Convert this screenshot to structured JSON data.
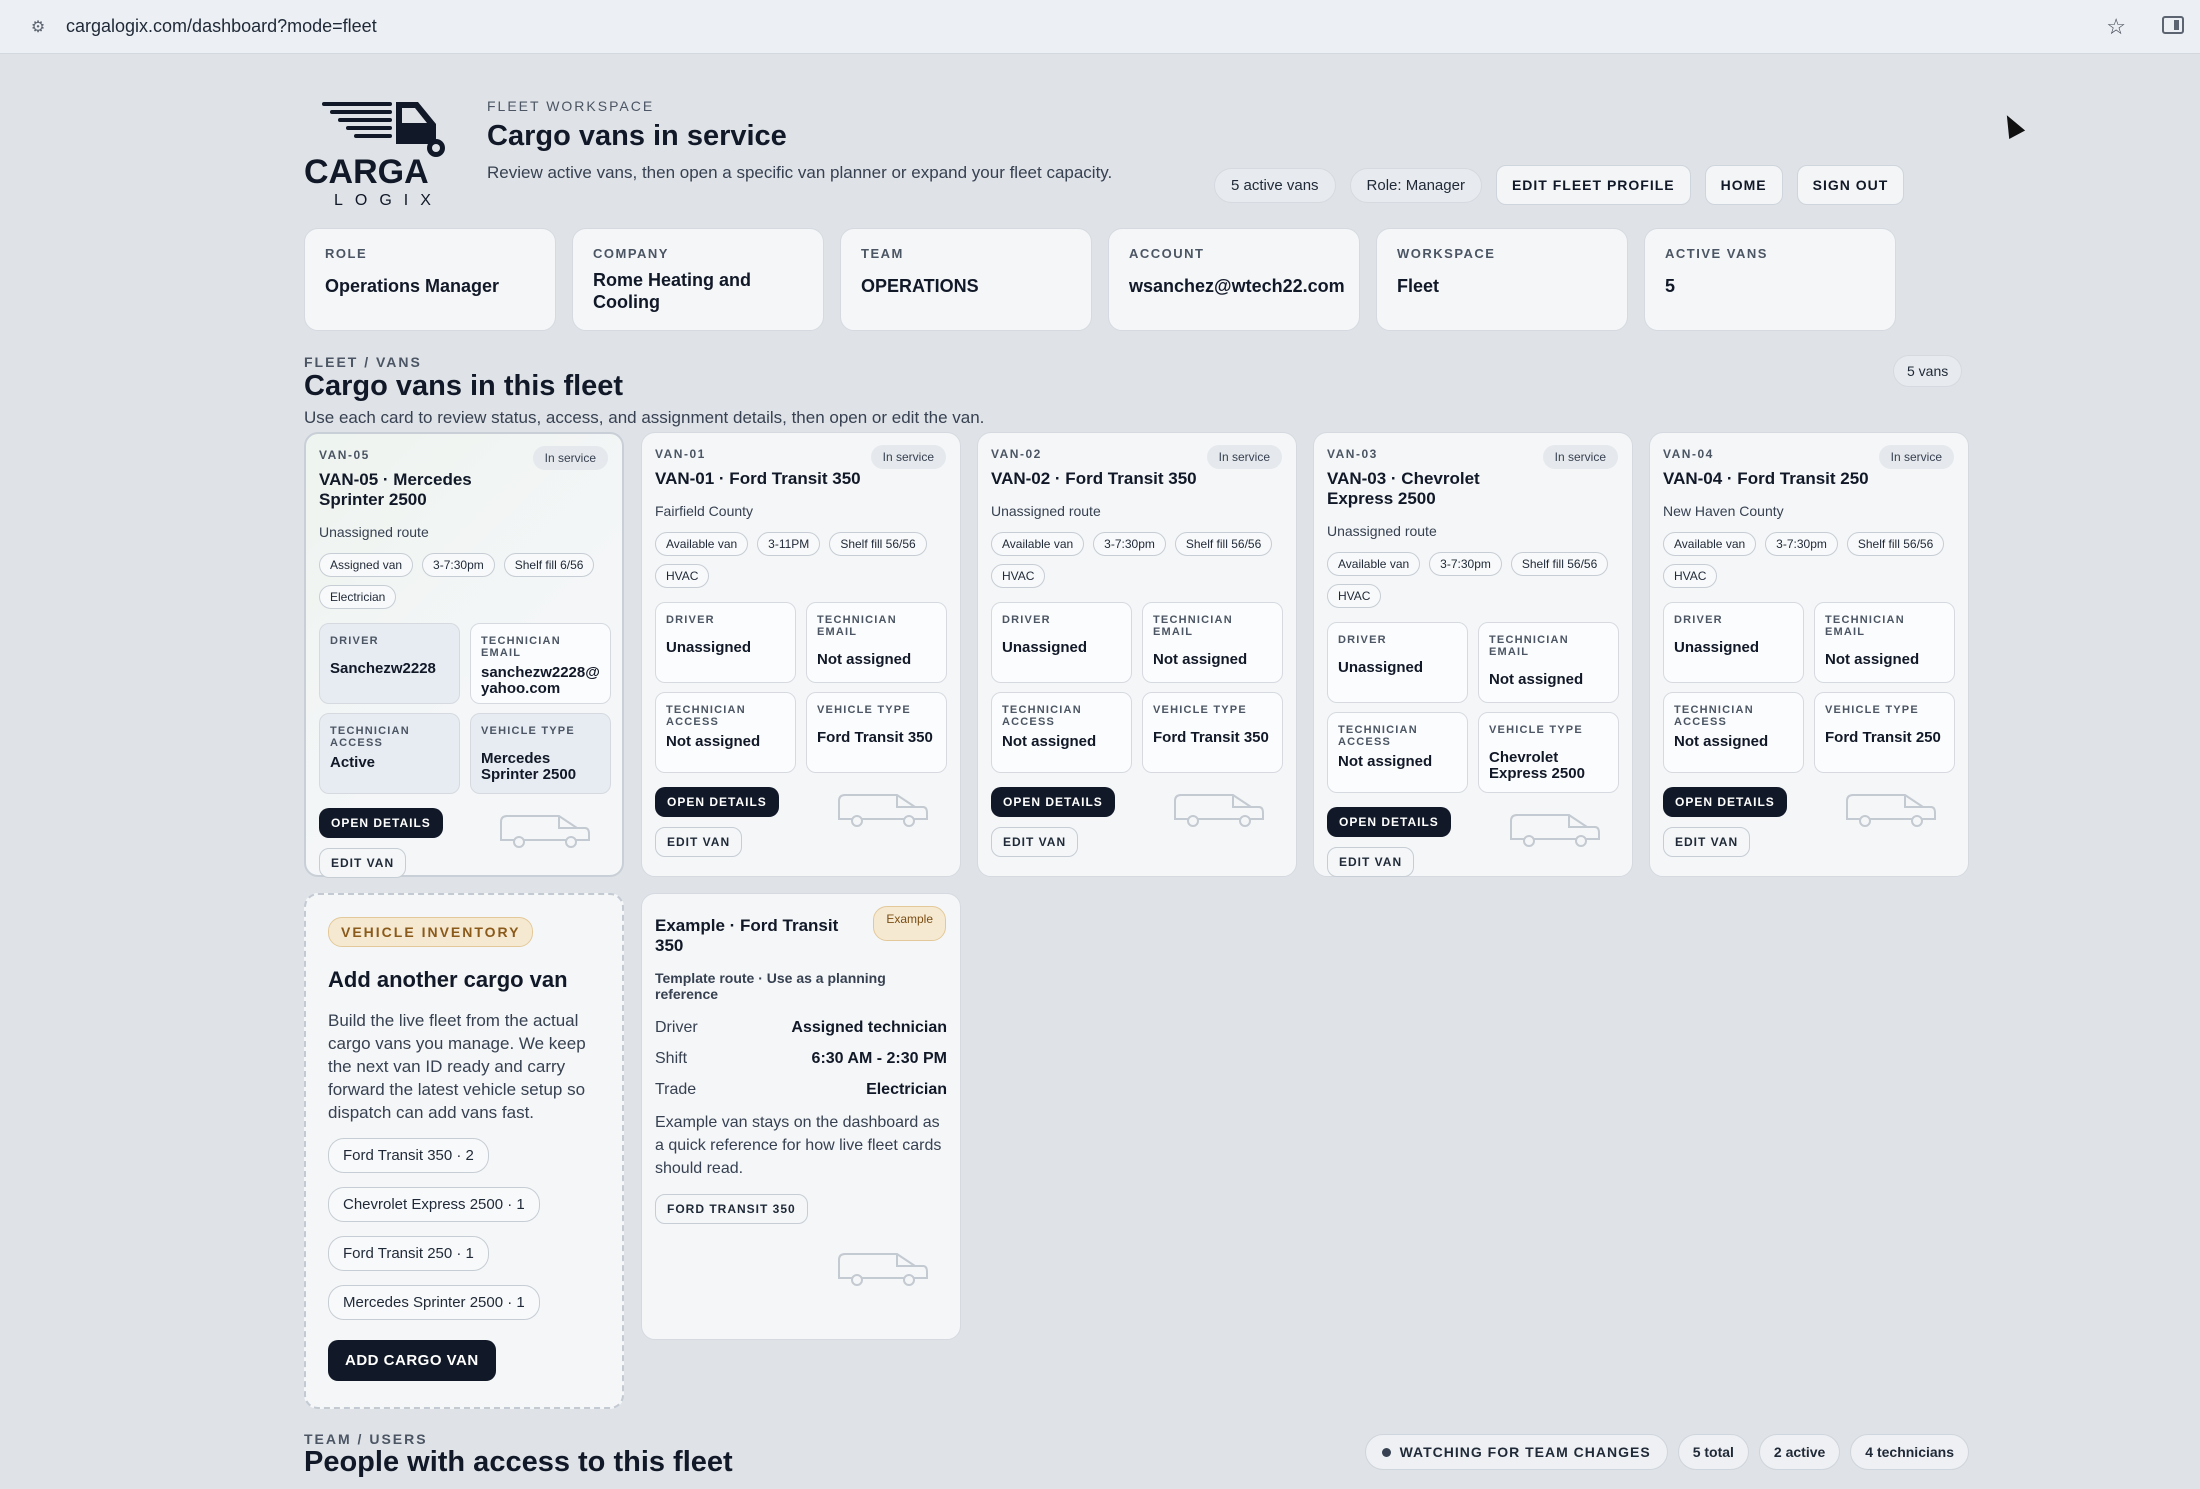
{
  "browser": {
    "url": "cargalogix.com/dashboard?mode=fleet"
  },
  "header": {
    "eyebrow": "FLEET WORKSPACE",
    "title": "Cargo vans in service",
    "subtitle": "Review active vans, then open a specific van planner or expand your fleet capacity.",
    "active_vans_pill": "5 active vans",
    "role_pill": "Role: Manager",
    "edit_profile": "EDIT FLEET PROFILE",
    "home": "HOME",
    "sign_out": "SIGN OUT",
    "logo_text": "CARGA",
    "logo_sub": "LOGIX"
  },
  "info_cards": [
    {
      "label": "ROLE",
      "value": "Operations Manager"
    },
    {
      "label": "COMPANY",
      "value": "Rome Heating and Cooling"
    },
    {
      "label": "TEAM",
      "value": "OPERATIONS"
    },
    {
      "label": "ACCOUNT",
      "value": "wsanchez@wtech22.com"
    },
    {
      "label": "WORKSPACE",
      "value": "Fleet"
    },
    {
      "label": "ACTIVE VANS",
      "value": "5"
    }
  ],
  "fleet": {
    "eyebrow": "FLEET / VANS",
    "title": "Cargo vans in this fleet",
    "desc": "Use each card to review status, access, and assignment details, then open or edit the van.",
    "count_pill": "5 vans",
    "labels": {
      "driver": "DRIVER",
      "tech_email": "TECHNICIAN EMAIL",
      "tech_access": "TECHNICIAN ACCESS",
      "vehicle_type": "VEHICLE TYPE",
      "open_details": "OPEN DETAILS",
      "edit_van": "EDIT VAN"
    },
    "vans": [
      {
        "id": "VAN-05",
        "name": "VAN-05 · Mercedes Sprinter 2500",
        "status": "In service",
        "route": "Unassigned route",
        "tags": [
          "Assigned van",
          "3-7:30pm",
          "Shelf fill 6/56",
          "Electrician"
        ],
        "driver": "Sanchezw2228",
        "tech_email": "sanchezw2228@yahoo.com",
        "tech_access": "Active",
        "vehicle_type": "Mercedes Sprinter 2500"
      },
      {
        "id": "VAN-01",
        "name": "VAN-01 · Ford Transit 350",
        "status": "In service",
        "route": "Fairfield County",
        "tags": [
          "Available van",
          "3-11PM",
          "Shelf fill 56/56",
          "HVAC"
        ],
        "driver": "Unassigned",
        "tech_email": "Not assigned",
        "tech_access": "Not assigned",
        "vehicle_type": "Ford Transit 350"
      },
      {
        "id": "VAN-02",
        "name": "VAN-02 · Ford Transit 350",
        "status": "In service",
        "route": "Unassigned route",
        "tags": [
          "Available van",
          "3-7:30pm",
          "Shelf fill 56/56",
          "HVAC"
        ],
        "driver": "Unassigned",
        "tech_email": "Not assigned",
        "tech_access": "Not assigned",
        "vehicle_type": "Ford Transit 350"
      },
      {
        "id": "VAN-03",
        "name": "VAN-03 · Chevrolet Express 2500",
        "status": "In service",
        "route": "Unassigned route",
        "tags": [
          "Available van",
          "3-7:30pm",
          "Shelf fill 56/56",
          "HVAC"
        ],
        "driver": "Unassigned",
        "tech_email": "Not assigned",
        "tech_access": "Not assigned",
        "vehicle_type": "Chevrolet Express 2500"
      },
      {
        "id": "VAN-04",
        "name": "VAN-04 · Ford Transit 250",
        "status": "In service",
        "route": "New Haven County",
        "tags": [
          "Available van",
          "3-7:30pm",
          "Shelf fill 56/56",
          "HVAC"
        ],
        "driver": "Unassigned",
        "tech_email": "Not assigned",
        "tech_access": "Not assigned",
        "vehicle_type": "Ford Transit 250"
      }
    ]
  },
  "inventory": {
    "badge": "VEHICLE INVENTORY",
    "title": "Add another cargo van",
    "desc": "Build the live fleet from the actual cargo vans you manage. We keep the next van ID ready and carry forward the latest vehicle setup so dispatch can add vans fast.",
    "items": [
      "Ford Transit 350 · 2",
      "Chevrolet Express 2500 · 1",
      "Ford Transit 250 · 1",
      "Mercedes Sprinter 2500 · 1"
    ],
    "add_button": "ADD CARGO VAN"
  },
  "example": {
    "name": "Example · Ford Transit 350",
    "badge": "Example",
    "route": "Template route · Use as a planning reference",
    "rows": [
      {
        "k": "Driver",
        "v": "Assigned technician"
      },
      {
        "k": "Shift",
        "v": "6:30 AM - 2:30 PM"
      },
      {
        "k": "Trade",
        "v": "Electrician"
      }
    ],
    "desc": "Example van stays on the dashboard as a quick reference for how live fleet cards should read.",
    "tag": "FORD TRANSIT 350"
  },
  "team": {
    "eyebrow": "TEAM / USERS",
    "title": "People with access to this fleet",
    "watching": "WATCHING FOR TEAM CHANGES",
    "total": "5 total",
    "active": "2 active",
    "technicians": "4 technicians"
  },
  "colors": {
    "primary_dark": "#111827",
    "page_bg": "#dfe3e8",
    "card_bg": "#f4f6f8",
    "inventory_accent": "#8a5a1a"
  }
}
